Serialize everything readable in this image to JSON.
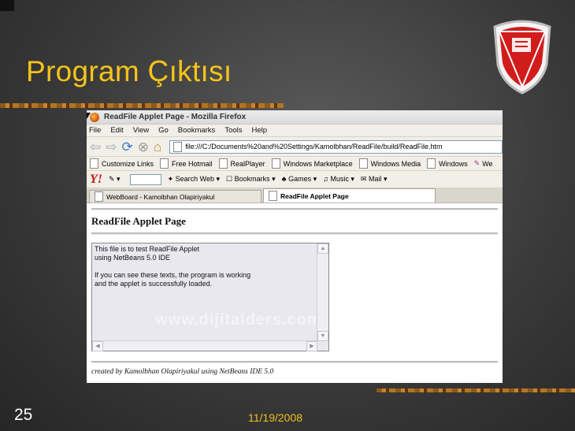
{
  "slide": {
    "title": "Program Çıktısı",
    "number": "25",
    "date": "11/19/2008"
  },
  "browser": {
    "window_title": "ReadFile Applet Page - Mozilla Firefox",
    "menu": [
      "File",
      "Edit",
      "View",
      "Go",
      "Bookmarks",
      "Tools",
      "Help"
    ],
    "url": "file:///C:/Documents%20and%20Settings/Kamolbhan/ReadFile/build/ReadFile.htm",
    "links": [
      "Customize Links",
      "Free Hotmail",
      "RealPlayer",
      "Windows Marketplace",
      "Windows Media",
      "Windows",
      "We"
    ],
    "yahoo": {
      "logo": "Y!",
      "search_label": "Search Web",
      "items": [
        "Bookmarks",
        "Games",
        "Music",
        "Mail"
      ]
    },
    "tabs": [
      {
        "label": "WebBoard - Kamolbhan Olapiriyakul",
        "active": false
      },
      {
        "label": "ReadFile Applet Page",
        "active": true
      }
    ]
  },
  "page": {
    "heading": "ReadFile Applet Page",
    "applet_text": "This file is to test ReadFile Applet\nusing NetBeans 5.0 IDE\n\nIf you can see these texts, the program is working\nand the applet is successfully loaded.",
    "watermark": "www.dijitalders.com",
    "credit": "created by Kamolbhan Olapiriyakul using NetBeans IDE 5.0"
  },
  "colors": {
    "title": "#f5c419",
    "date": "#f0c020",
    "logo_red": "#d11c1c"
  }
}
